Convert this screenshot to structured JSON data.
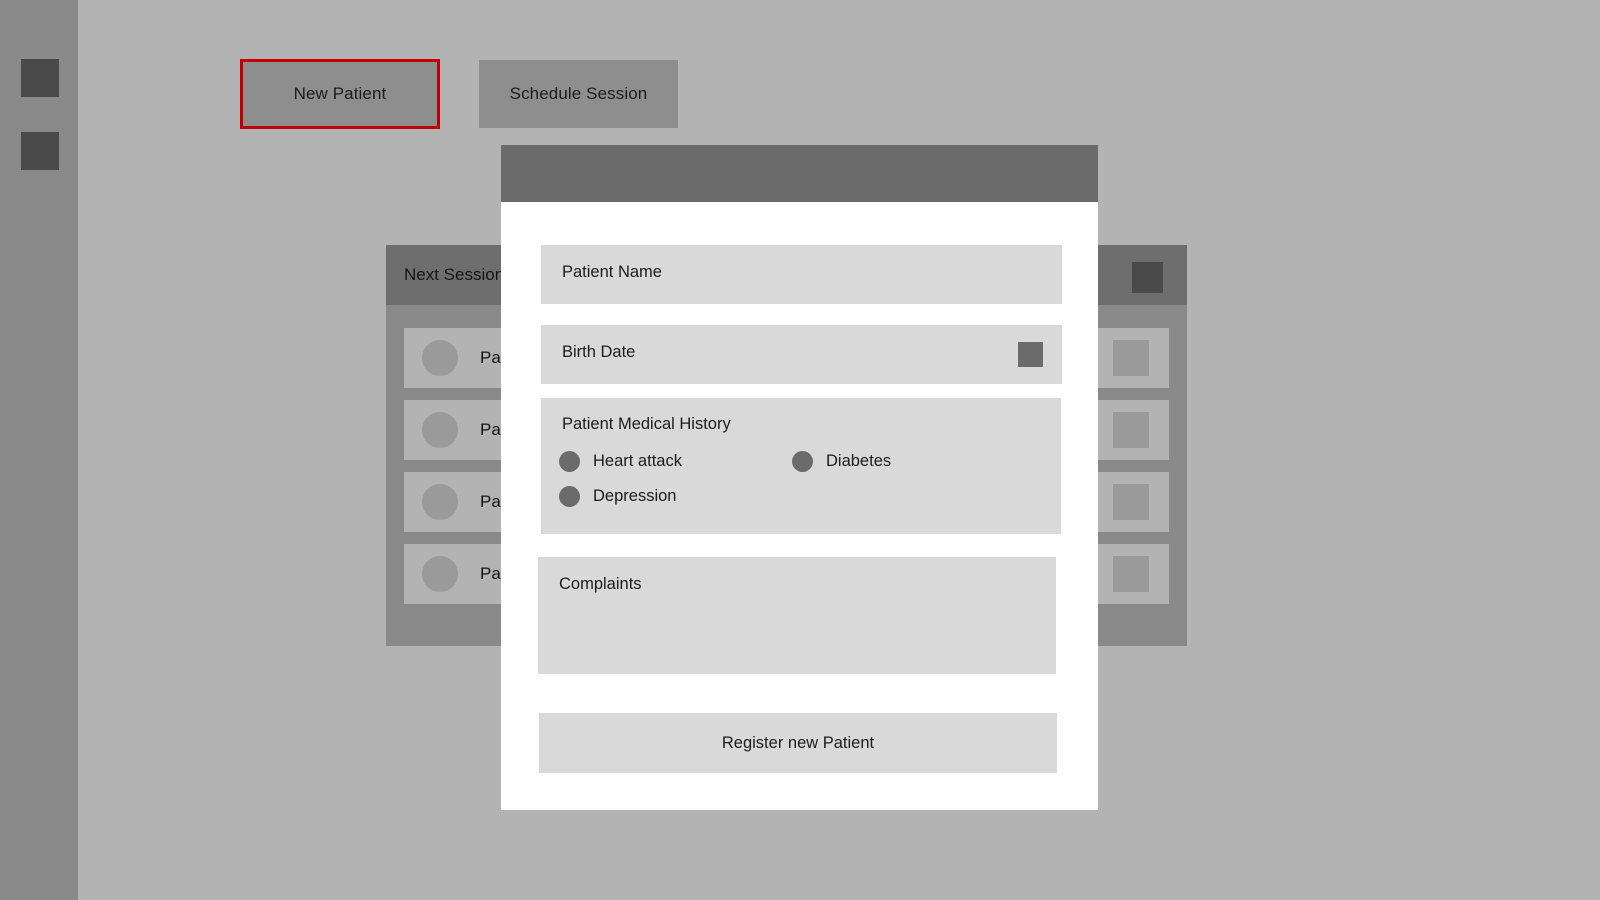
{
  "sidebar": {
    "icons": [
      {
        "name": "menu-icon"
      },
      {
        "name": "dashboard-icon"
      }
    ]
  },
  "toolbar": {
    "new_patient_label": "New Patient",
    "schedule_session_label": "Schedule Session",
    "highlight_color": "#c00000"
  },
  "next_session_panel": {
    "title": "Next Session",
    "header_action_icon": "square-icon",
    "rows": [
      {
        "label": "Patient",
        "avatar": "avatar-circle",
        "thumb": "thumbnail-square"
      },
      {
        "label": "Patient",
        "avatar": "avatar-circle",
        "thumb": "thumbnail-square"
      },
      {
        "label": "Patient",
        "avatar": "avatar-circle",
        "thumb": "thumbnail-square"
      },
      {
        "label": "Patient",
        "avatar": "avatar-circle",
        "thumb": "thumbnail-square"
      }
    ]
  },
  "modal": {
    "fields": {
      "patient_name_label": "Patient Name",
      "birth_date_label": "Birth Date",
      "birth_date_icon": "calendar-icon",
      "medical_history_label": "Patient Medical History",
      "complaints_label": "Complaints"
    },
    "medical_history_options": [
      {
        "label": "Heart attack"
      },
      {
        "label": "Diabetes"
      },
      {
        "label": "Depression"
      }
    ],
    "submit_label": "Register new Patient"
  },
  "colors": {
    "page_background": "#b3b3b3",
    "sidebar": "#898989",
    "button": "#8e8e8e",
    "panel": "#898989",
    "panel_header": "#6e6e6e",
    "modal_titlebar": "#6b6b6b",
    "field": "#d9d9d9",
    "dark_icon": "#4a4a4a"
  }
}
